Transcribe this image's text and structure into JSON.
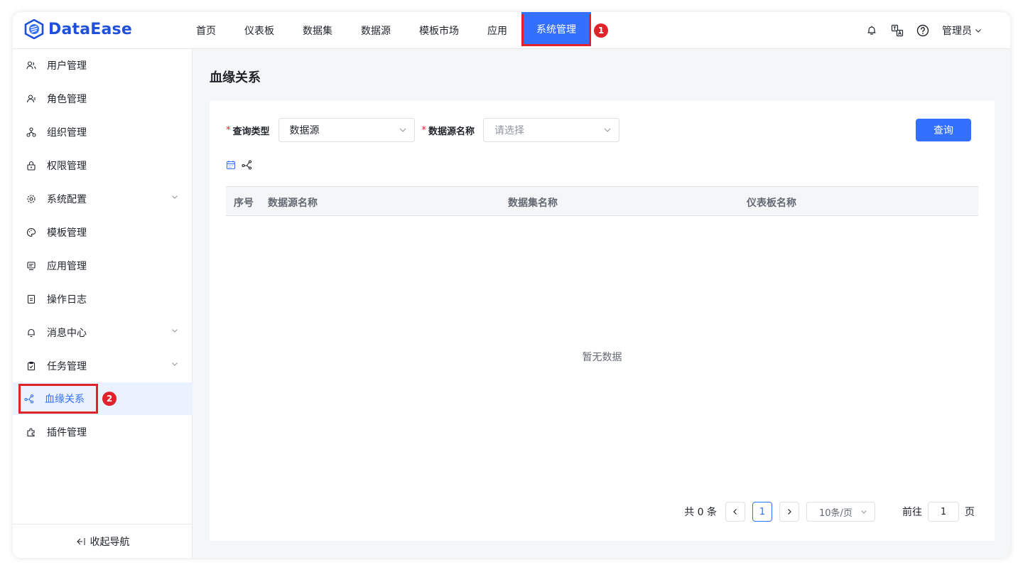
{
  "header": {
    "logo_text": "DataEase",
    "nav": [
      {
        "label": "首页"
      },
      {
        "label": "仪表板"
      },
      {
        "label": "数据集"
      },
      {
        "label": "数据源"
      },
      {
        "label": "模板市场"
      },
      {
        "label": "应用"
      },
      {
        "label": "系统管理",
        "active": true
      }
    ],
    "badge_1": "1",
    "user_label": "管理员",
    "icons": [
      "notification-icon",
      "translate-icon",
      "help-icon",
      "chevron-down-icon"
    ]
  },
  "sidebar": {
    "items": [
      {
        "label": "用户管理",
        "icon": "users-icon"
      },
      {
        "label": "角色管理",
        "icon": "role-icon"
      },
      {
        "label": "组织管理",
        "icon": "org-icon"
      },
      {
        "label": "权限管理",
        "icon": "lock-icon"
      },
      {
        "label": "系统配置",
        "icon": "gear-icon",
        "expandable": true
      },
      {
        "label": "模板管理",
        "icon": "palette-icon"
      },
      {
        "label": "应用管理",
        "icon": "app-icon"
      },
      {
        "label": "操作日志",
        "icon": "log-icon"
      },
      {
        "label": "消息中心",
        "icon": "bell-icon",
        "expandable": true
      },
      {
        "label": "任务管理",
        "icon": "task-icon",
        "expandable": true
      },
      {
        "label": "血缘关系",
        "icon": "lineage-icon",
        "active": true
      },
      {
        "label": "插件管理",
        "icon": "plugin-icon"
      }
    ],
    "badge_2": "2",
    "collapse_label": "收起导航"
  },
  "main": {
    "title": "血缘关系",
    "form": {
      "query_type_label": "查询类型",
      "query_type_value": "数据源",
      "source_name_label": "数据源名称",
      "source_name_placeholder": "请选择",
      "query_button": "查询"
    },
    "table": {
      "headers": [
        "序号",
        "数据源名称",
        "数据集名称",
        "仪表板名称"
      ],
      "empty_text": "暂无数据"
    },
    "pager": {
      "total_text": "共 0 条",
      "current_page": "1",
      "page_size": "10条/页",
      "goto_prefix": "前往",
      "goto_value": "1",
      "goto_suffix": "页"
    }
  },
  "colors": {
    "primary": "#3370ff",
    "annotation_red": "#e0232a"
  }
}
